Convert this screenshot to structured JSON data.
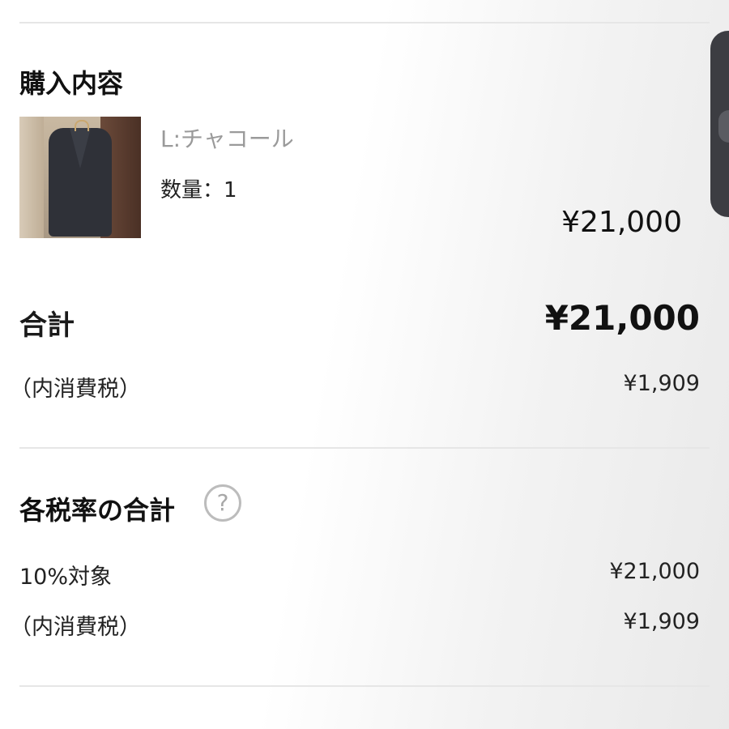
{
  "purchase": {
    "title": "購入内容",
    "item": {
      "variant": "L:チャコール",
      "quantity_label": "数量：1",
      "price": "¥21,000"
    },
    "total_label": "合計",
    "total_value": "¥21,000",
    "tax_label": "（内消費税）",
    "tax_value": "¥1,909"
  },
  "tax_rates": {
    "title": "各税率の合計",
    "help_icon": "?",
    "rate_label": "10%対象",
    "rate_value": "¥21,000",
    "tax_label": "（内消費税）",
    "tax_value": "¥1,909"
  }
}
